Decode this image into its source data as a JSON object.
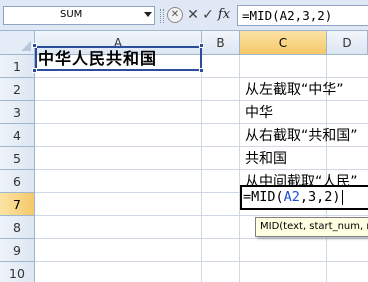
{
  "formula_bar": {
    "name_box": "SUM",
    "formula": "=MID(A2,3,2)",
    "icons": [
      "dropdown-arrow-icon",
      "cancel-icon",
      "close-icon",
      "check-icon",
      "fx-icon"
    ]
  },
  "columns": [
    "A",
    "B",
    "C",
    "D"
  ],
  "rows": [
    "1",
    "2",
    "3",
    "4",
    "5",
    "6",
    "7",
    "8",
    "9",
    "10"
  ],
  "cells": {
    "A2": "中华人民共和国",
    "C2": "从左截取“中华”",
    "C3": "中华",
    "C4": "从右截取“共和国”",
    "C5": "共和国",
    "C6": "从中间截取“人民”"
  },
  "editing": {
    "cell": "C7",
    "prefix": "=MID(",
    "ref": "A2",
    "suffix": ",3,2)"
  },
  "tooltip": "MID(text, start_num, num_chars)",
  "colors": {
    "selection_border": "#2b4b9b",
    "reference_blue": "#1f4fd1",
    "header_selected": "#f5c86a",
    "gridline": "#d0d7e5"
  }
}
